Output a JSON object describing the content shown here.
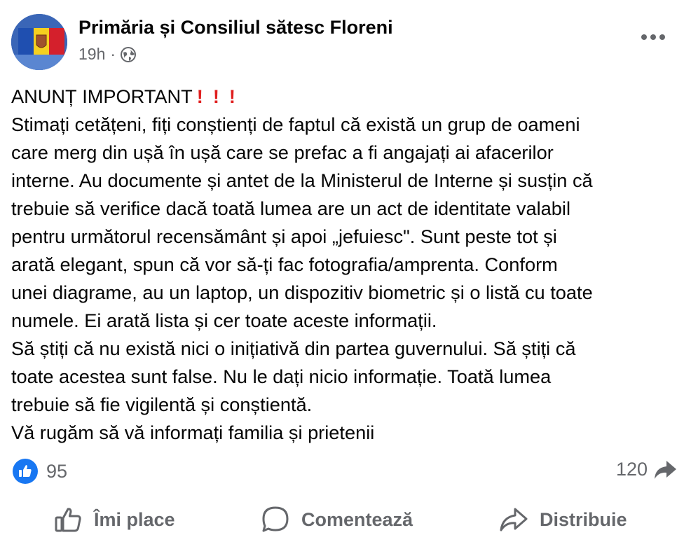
{
  "post": {
    "author": "Primăria și Consiliul sătesc Floreni",
    "time": "19h",
    "separator": "·",
    "audience_icon": "globe-icon",
    "more_icon": "more-options-icon",
    "avatar": "moldova-flag-avatar"
  },
  "content": {
    "heading": "ANUNȚ IMPORTANT",
    "heading_marks": "!!!",
    "lines": [
      "Stimați cetățeni, fiți conștienți de faptul că există un grup de oameni",
      "care merg din ușă în ușă care se prefac a fi angajați ai afacerilor",
      "interne. Au documente și antet de la Ministerul de Interne și susțin că",
      "trebuie să verifice dacă toată lumea are un act de identitate valabil",
      "pentru următorul recensământ și apoi „jefuiesc\". Sunt peste tot și",
      "arată elegant, spun că vor să-ți fac fotografia/amprenta. Conform",
      "unei diagrame, au un laptop, un dispozitiv biometric și o listă cu toate",
      "numele. Ei arată lista și cer toate aceste informații.",
      "Să știți că nu există nici o inițiativă din partea guvernului. Să știți că",
      "toate acestea sunt false. Nu le dați nicio informație. Toată lumea",
      "trebuie să fie vigilentă și conștientă.",
      "Vă rugăm să vă informați familia și prietenii"
    ]
  },
  "stats": {
    "likes": "95",
    "shares": "120"
  },
  "actions": {
    "like": "Îmi place",
    "comment": "Comentează",
    "share": "Distribuie"
  },
  "colors": {
    "like_blue": "#1877f2",
    "exclamation_red": "#e02020",
    "muted_gray": "#65676b"
  }
}
